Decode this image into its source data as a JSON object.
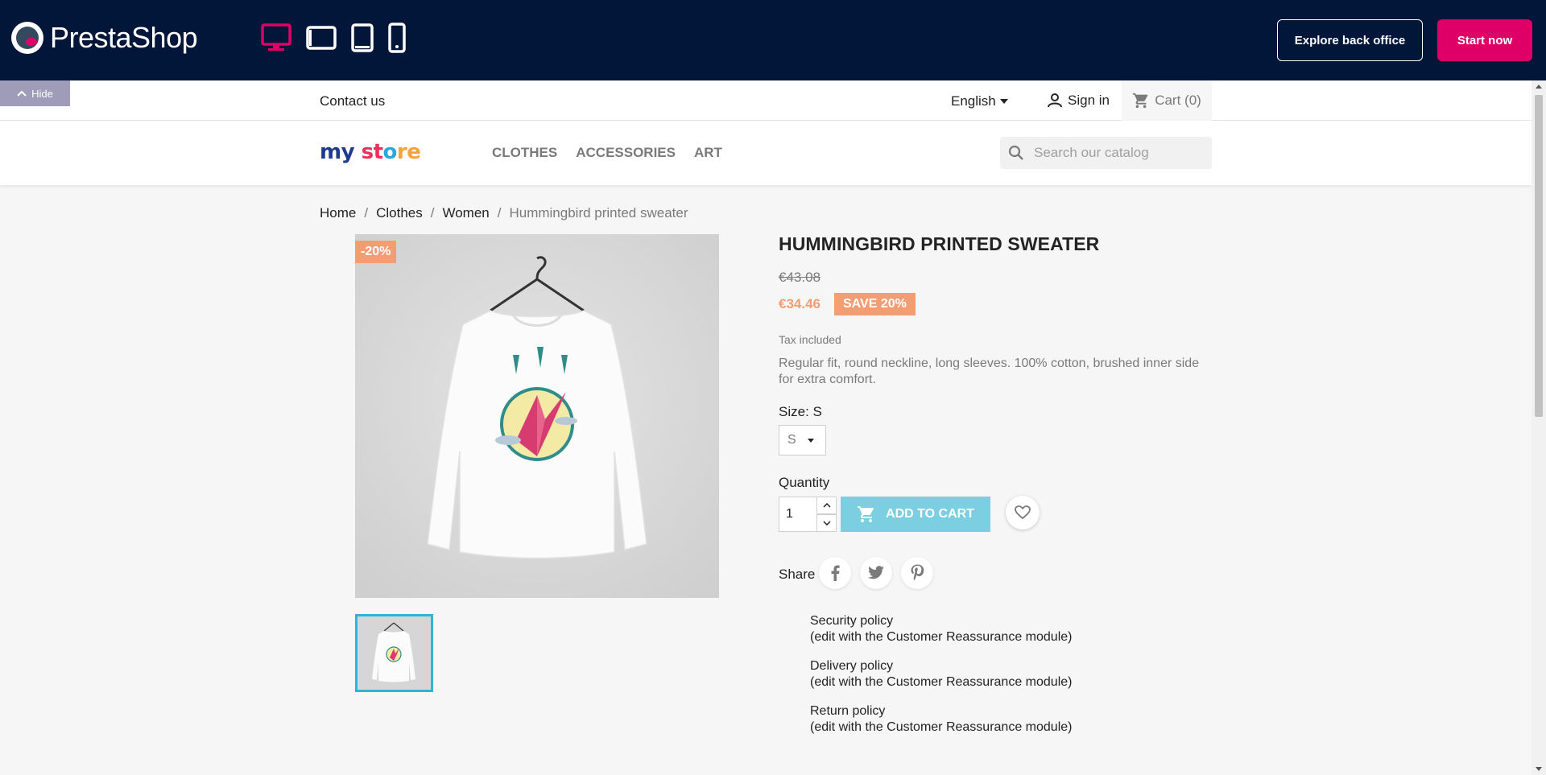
{
  "demo_bar": {
    "brand": "PrestaShop",
    "devices": [
      "desktop-icon",
      "tablet-landscape-icon",
      "tablet-portrait-icon",
      "mobile-icon"
    ],
    "explore_label": "Explore back office",
    "start_label": "Start now",
    "hide_label": "Hide",
    "colors": {
      "bg": "#011638",
      "accent": "#df0067"
    }
  },
  "header": {
    "contact": "Contact us",
    "language": "English",
    "sign_in": "Sign in",
    "cart": "Cart (0)",
    "logo": {
      "c1": "my",
      "c2": "st",
      "c3": "o",
      "c4": "re"
    },
    "menu": [
      "CLOTHES",
      "ACCESSORIES",
      "ART"
    ],
    "search_placeholder": "Search our catalog"
  },
  "breadcrumb": [
    "Home",
    "Clothes",
    "Women",
    "Hummingbird printed sweater"
  ],
  "product": {
    "discount_flag": "-20%",
    "title": "HUMMINGBIRD PRINTED SWEATER",
    "old_price": "€43.08",
    "price": "€34.46",
    "save_badge": "SAVE 20%",
    "tax": "Tax included",
    "description": "Regular fit, round neckline, long sleeves. 100% cotton, brushed inner side for extra comfort.",
    "size_label": "Size: S",
    "size_value": "S",
    "quantity_label": "Quantity",
    "quantity_value": "1",
    "add_to_cart": "ADD TO CART",
    "share_label": "Share",
    "colors": {
      "primary": "#2fb5d2",
      "discount": "#f39d72"
    }
  },
  "reassurance": [
    {
      "title": "Security policy",
      "note": "(edit with the Customer Reassurance module)"
    },
    {
      "title": "Delivery policy",
      "note": "(edit with the Customer Reassurance module)"
    },
    {
      "title": "Return policy",
      "note": "(edit with the Customer Reassurance module)"
    }
  ]
}
